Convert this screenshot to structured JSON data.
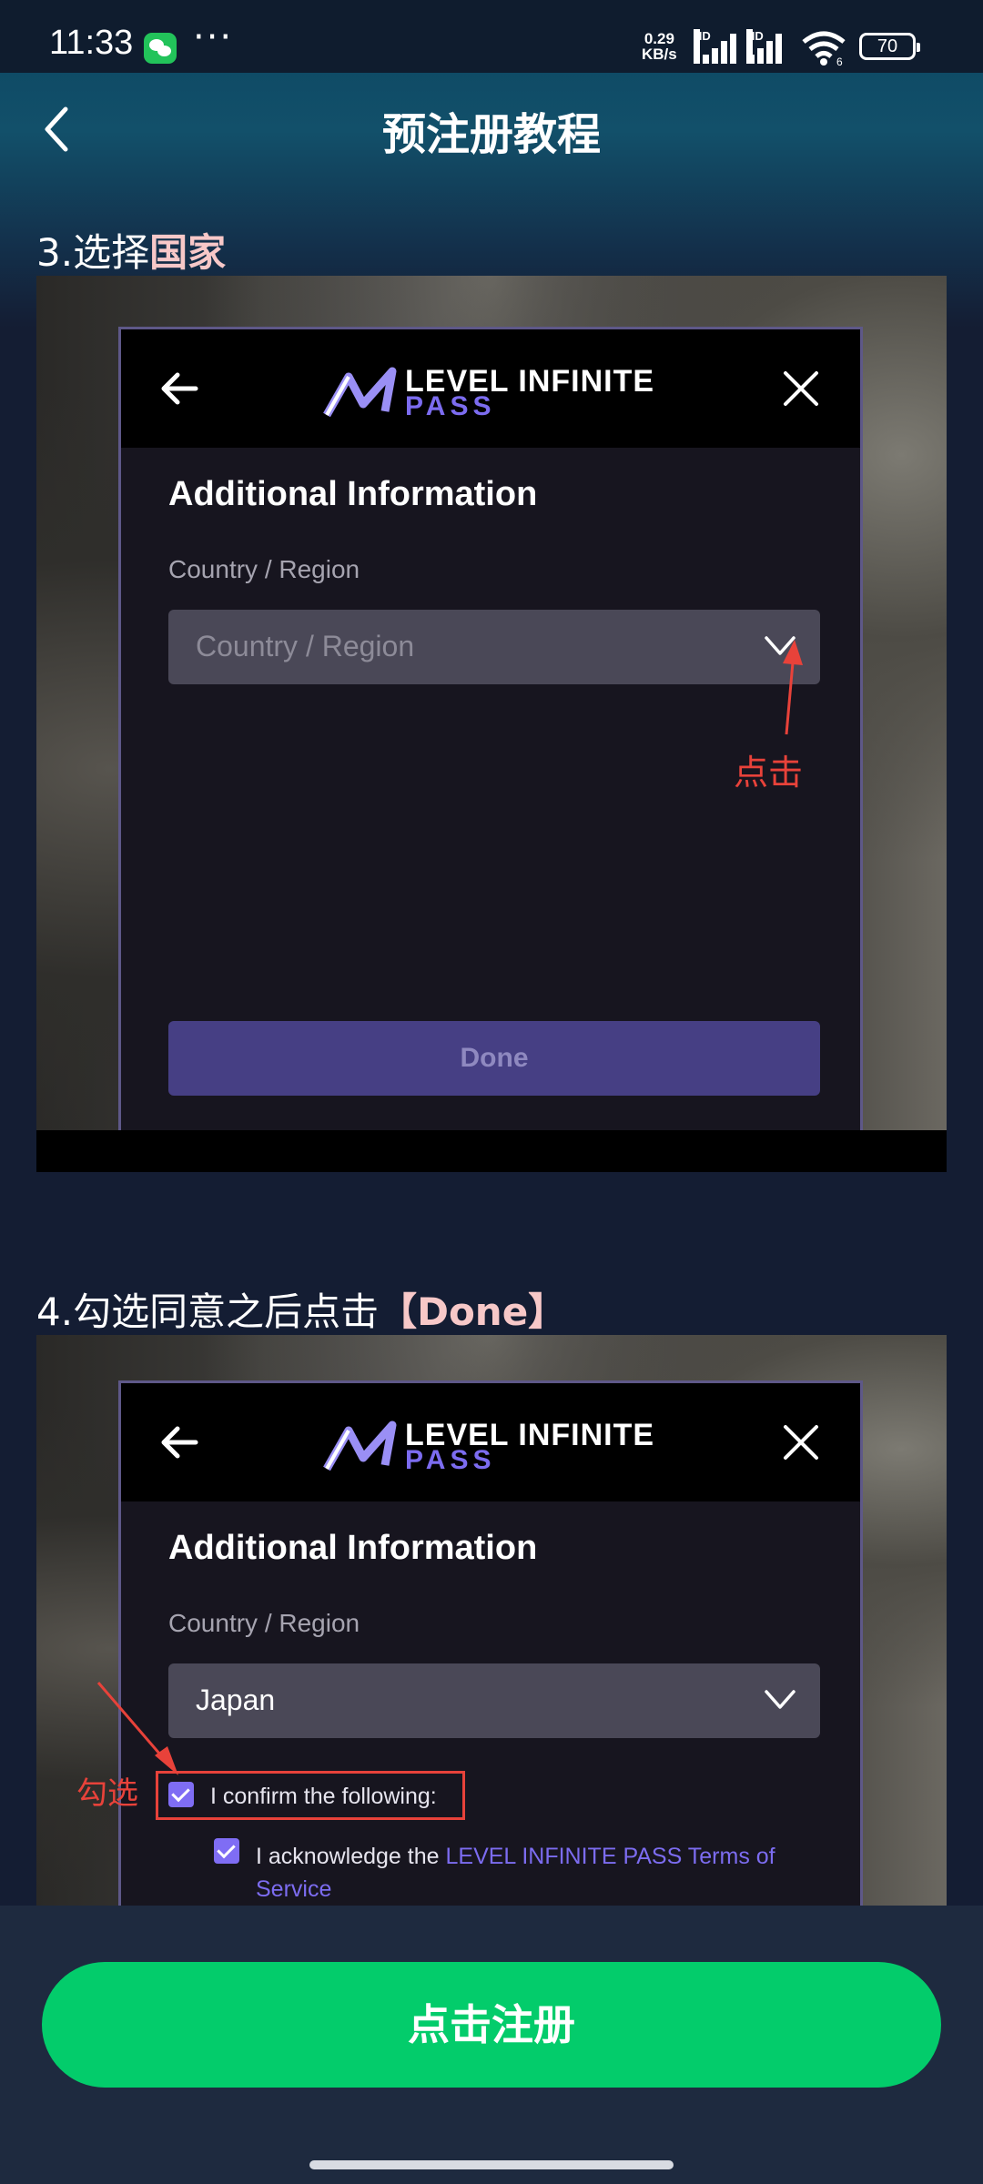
{
  "status_bar": {
    "time": "11:33",
    "dots": "···",
    "speed_top": "0.29",
    "speed_bottom": "KB/s",
    "hd_label": "HD",
    "wifi_sub": "6",
    "battery": "70"
  },
  "header": {
    "title": "预注册教程"
  },
  "step3": {
    "prefix": "3.选择",
    "highlight": "国家",
    "dialog": {
      "logo_line1": "LEVEL INFINITE",
      "logo_line2": "PASS",
      "heading": "Additional Information",
      "field_label": "Country / Region",
      "select_placeholder": "Country / Region",
      "done_label": "Done"
    },
    "annotation": "点击"
  },
  "step4": {
    "prefix": "4.勾选同意之后点击",
    "highlight": "【Done】",
    "dialog": {
      "logo_line1": "LEVEL INFINITE",
      "logo_line2": "PASS",
      "heading": "Additional Information",
      "field_label": "Country / Region",
      "select_value": "Japan",
      "confirm_label": "I confirm the following:",
      "ack_prefix": "I acknowledge the ",
      "ack_link": "LEVEL INFINITE PASS Terms of",
      "ack_link_2": "Service"
    },
    "annotation": "勾选"
  },
  "bottom": {
    "register_label": "点击注册"
  },
  "colors": {
    "accent_green": "#03cc6b",
    "annotation_red": "#e8423a",
    "link_purple": "#7c6cf0"
  }
}
